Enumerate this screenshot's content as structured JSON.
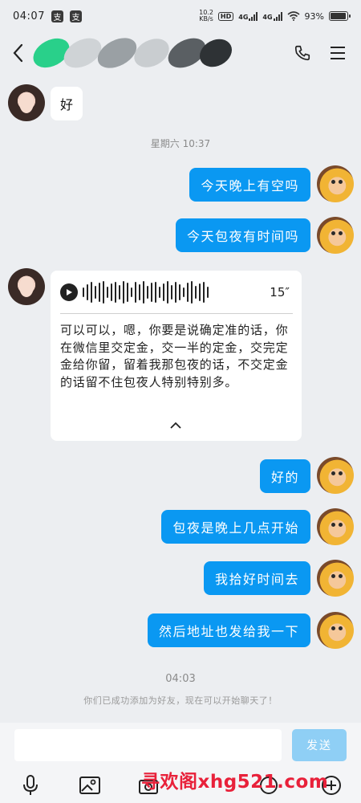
{
  "status_bar": {
    "time": "04:07",
    "app_icons": [
      "支",
      "支"
    ],
    "net_speed_value": "10.2",
    "net_speed_unit": "KB/s",
    "hd": "HD",
    "signal1": "4G",
    "signal2": "4G",
    "battery": "93%",
    "battery_level": 0.93
  },
  "header": {
    "back_icon": "chevron-left-icon",
    "call_icon": "phone-icon",
    "menu_icon": "menu-icon"
  },
  "messages": {
    "m1": "好",
    "time1": "星期六 10:37",
    "m2": "今天晚上有空吗",
    "m3": "今天包夜有时间吗",
    "voice_duration": "15″",
    "transcript": "可以可以，嗯，你要是说确定准的话，你在微信里交定金，交一半的定金，交完定金给你留，留着我那包夜的话，不交定金的话留不住包夜人特别特别多。",
    "m4": "好的",
    "m5": "包夜是晚上几点开始",
    "m6": "我拾好时间去",
    "m7": "然后地址也发给我一下",
    "time2": "04:03",
    "system_notice": "你们已成功添加为好友，现在可以开始聊天了！"
  },
  "input": {
    "placeholder": "",
    "send_label": "发送"
  },
  "toolbar": {
    "icons": [
      "mic-icon",
      "image-icon",
      "camera-icon",
      "emoji-icon",
      "plus-icon"
    ]
  },
  "watermark": "寻欢阁xhg521.com",
  "colors": {
    "accent": "#0a98f2",
    "send_disabled": "#8fcff5",
    "background": "#eceef1"
  }
}
